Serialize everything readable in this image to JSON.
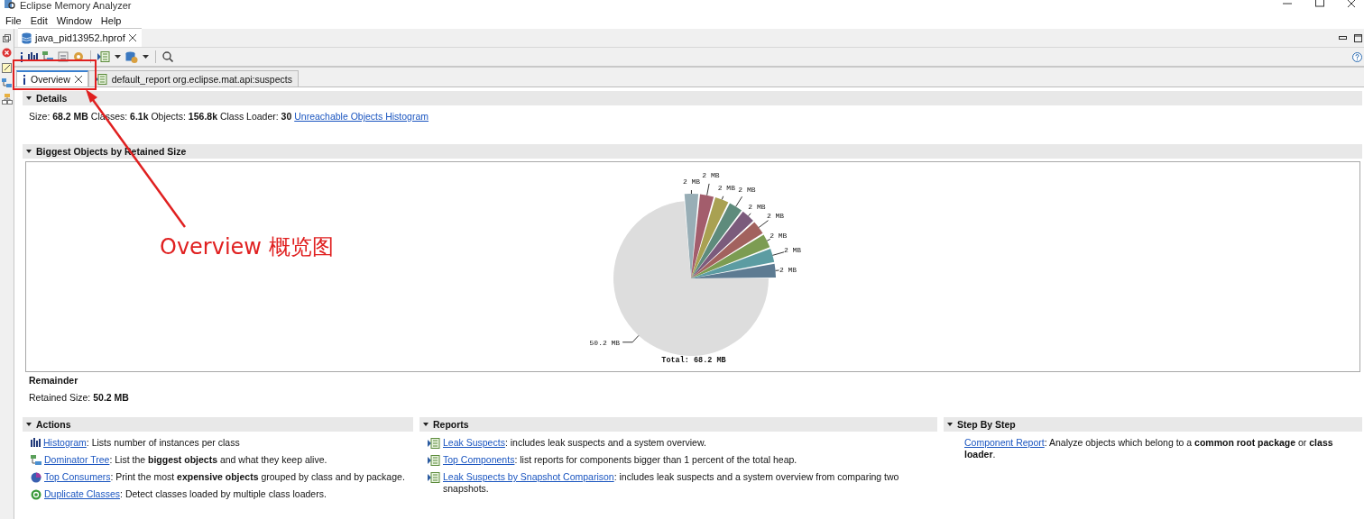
{
  "window": {
    "title": "Eclipse Memory Analyzer"
  },
  "menu": [
    "File",
    "Edit",
    "Window",
    "Help"
  ],
  "editor_tab": {
    "label": "java_pid13952.hprof",
    "selected": true
  },
  "inner_tabs": [
    {
      "label": "Overview",
      "selected": true,
      "kind": "info"
    },
    {
      "label": "default_report org.eclipse.mat.api:suspects",
      "selected": false,
      "kind": "report"
    }
  ],
  "details": {
    "title": "Details",
    "text": "Size: **68.2 MB** Classes: **6.1k** Objects: **156.8k** Class Loader: **30**",
    "link": "Unreachable Objects Histogram"
  },
  "biggest_objects": {
    "title": "Biggest Objects by Retained Size",
    "chart_data": {
      "type": "pie",
      "title": "Total: 68.2 MB",
      "values": [
        2,
        2,
        2,
        2,
        2,
        2,
        2,
        2,
        2,
        50.2
      ],
      "value_labels": [
        "2 MB",
        "2 MB",
        "2 MB",
        "2 MB",
        "2 MB",
        "2 MB",
        "2 MB",
        "2 MB",
        "2 MB",
        "50.2 MB"
      ],
      "colors": [
        "#98aeb6",
        "#a35d6c",
        "#a9a152",
        "#5e8b7c",
        "#7b5b7c",
        "#a2625e",
        "#7c9c52",
        "#5c9ca2",
        "#5d7b92",
        "#dddddd"
      ]
    },
    "remainder": {
      "title": "Remainder",
      "text": "Retained Size: **50.2 MB**"
    }
  },
  "actions": {
    "title": "Actions",
    "items": [
      {
        "kind": "histogram",
        "link": "Histogram",
        "text": ": Lists number of instances per class"
      },
      {
        "kind": "tree",
        "link": "Dominator Tree",
        "text": ": List the **biggest objects** and what they keep alive."
      },
      {
        "kind": "consumers",
        "link": "Top Consumers",
        "text": ": Print the most **expensive objects** grouped by class and by package."
      },
      {
        "kind": "duplicate",
        "link": "Duplicate Classes",
        "text": ": Detect classes loaded by multiple class loaders."
      }
    ]
  },
  "reports": {
    "title": "Reports",
    "items": [
      {
        "kind": "report",
        "link": "Leak Suspects",
        "text": ": includes leak suspects and a system overview."
      },
      {
        "kind": "report",
        "link": "Top Components",
        "text": ": list reports for components bigger than 1 percent of the total heap."
      },
      {
        "kind": "report",
        "link": "Leak Suspects by Snapshot Comparison",
        "text": ": includes leak suspects and a system overview from comparing two snapshots."
      }
    ]
  },
  "step_by_step": {
    "title": "Step By Step",
    "items": [
      {
        "link": "Component Report",
        "text": ": Analyze objects which belong to a **common root package** or **class loader**."
      }
    ]
  },
  "annotation": {
    "label": "Overview 概览图"
  }
}
